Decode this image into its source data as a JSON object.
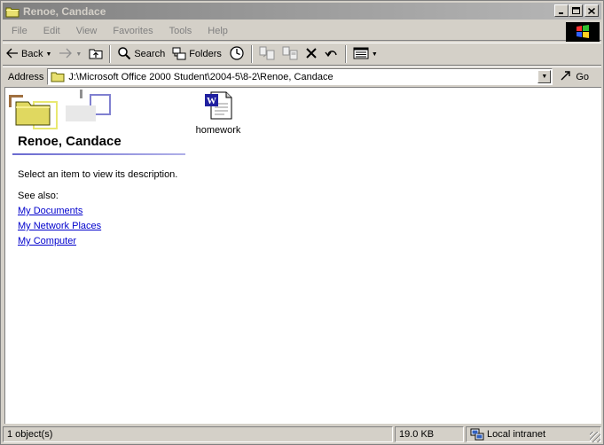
{
  "window": {
    "title": "Renoe, Candace"
  },
  "menu": {
    "items": [
      "File",
      "Edit",
      "View",
      "Favorites",
      "Tools",
      "Help"
    ]
  },
  "toolbar": {
    "back_label": "Back",
    "search_label": "Search",
    "folders_label": "Folders"
  },
  "address": {
    "label": "Address",
    "value": "J:\\Microsoft Office 2000 Student\\2004-5\\8-2\\Renoe, Candace",
    "go_label": "Go"
  },
  "panel": {
    "title": "Renoe, Candace",
    "description": "Select an item to view its description.",
    "see_also": "See also:",
    "links": [
      "My Documents",
      "My Network Places",
      "My Computer"
    ]
  },
  "files": [
    {
      "name": "homework",
      "icon": "word-document-icon"
    }
  ],
  "status": {
    "objects": "1 object(s)",
    "size": "19.0 KB",
    "zone": "Local intranet"
  },
  "colors": {
    "face": "#d4d0c8",
    "title_inactive_left": "#808080",
    "title_inactive_right": "#b8b8b8",
    "link": "#0000cc",
    "accent_rule": "#6a6ad0"
  }
}
